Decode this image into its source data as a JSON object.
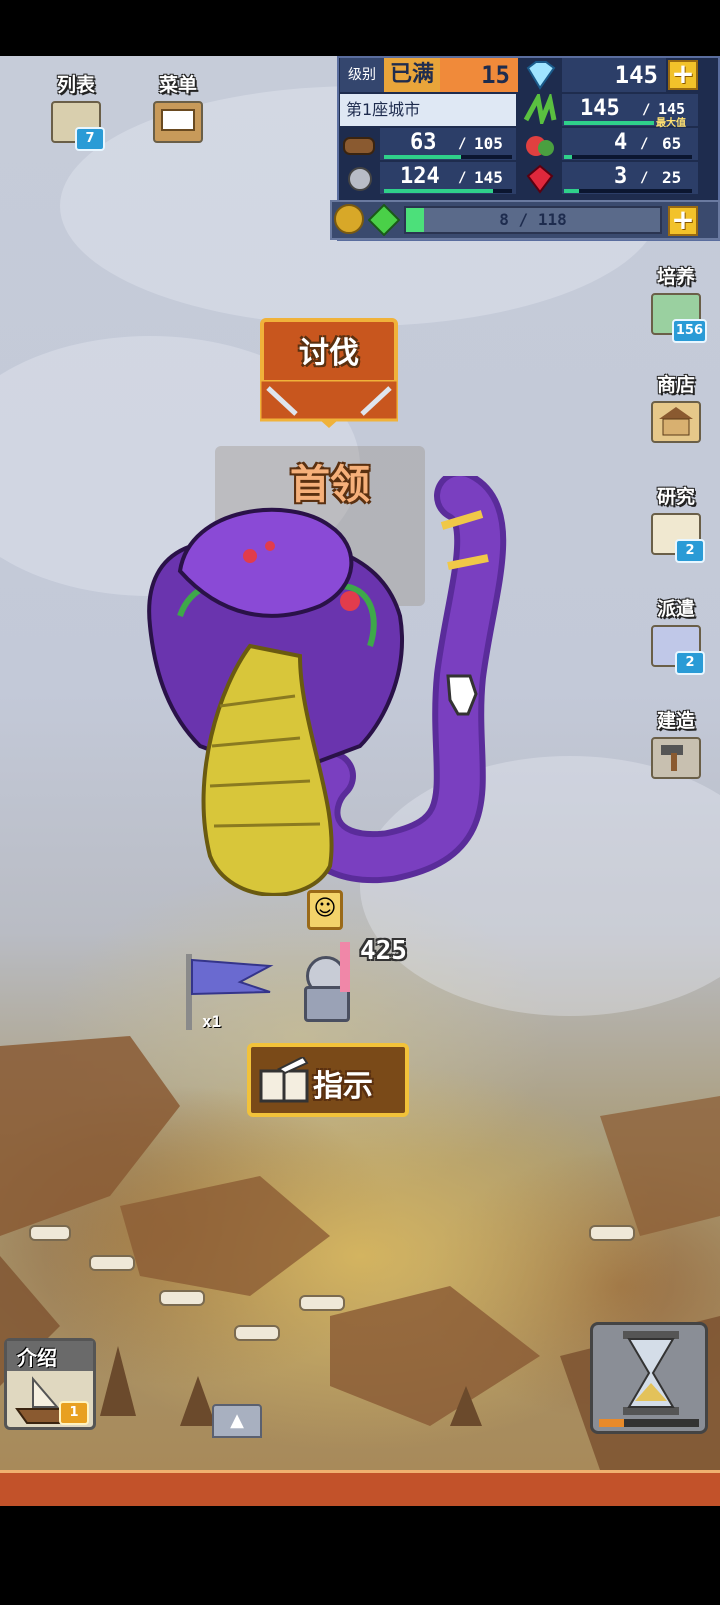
{
  "hud": {
    "level_label": "级别",
    "level_max": "已满",
    "level_value": "15",
    "city_name": "第1座城市",
    "gems": "145",
    "crops_current": "145",
    "crops_max": "145",
    "crops_max_tag": "最大值",
    "wood_current": "63",
    "wood_max": "105",
    "food_current": "4",
    "food_max": "65",
    "ore_current": "124",
    "ore_max": "145",
    "ruby_current": "3",
    "ruby_max": "25",
    "exp_text": "8 / 118",
    "exp_progress": 0.07,
    "wood_progress": 0.6,
    "crops_progress": 1.0,
    "food_progress": 0.06,
    "ore_progress": 0.855,
    "ruby_progress": 0.12,
    "sep": "/"
  },
  "left_menu": {
    "list_label": "列表",
    "list_badge": "7",
    "menu_label": "菜单"
  },
  "right_menu": [
    {
      "label": "培养",
      "badge": "156"
    },
    {
      "label": "商店",
      "badge": ""
    },
    {
      "label": "研究",
      "badge": "2"
    },
    {
      "label": "派遣",
      "badge": "2"
    },
    {
      "label": "建造",
      "badge": ""
    }
  ],
  "boss": {
    "subjugate_label": "讨伐",
    "boss_title": "首领"
  },
  "unit": {
    "power": "425",
    "flag_count": "x1"
  },
  "guide_button": "指示",
  "intro": {
    "label": "介绍",
    "badge": "1"
  },
  "timer_progress": 0.25,
  "colors": {
    "snake_purple": "#7a3fc0",
    "snake_belly": "#d8c63a",
    "hud_bg": "#1e2c4e",
    "accent_gold": "#f2c22a"
  }
}
